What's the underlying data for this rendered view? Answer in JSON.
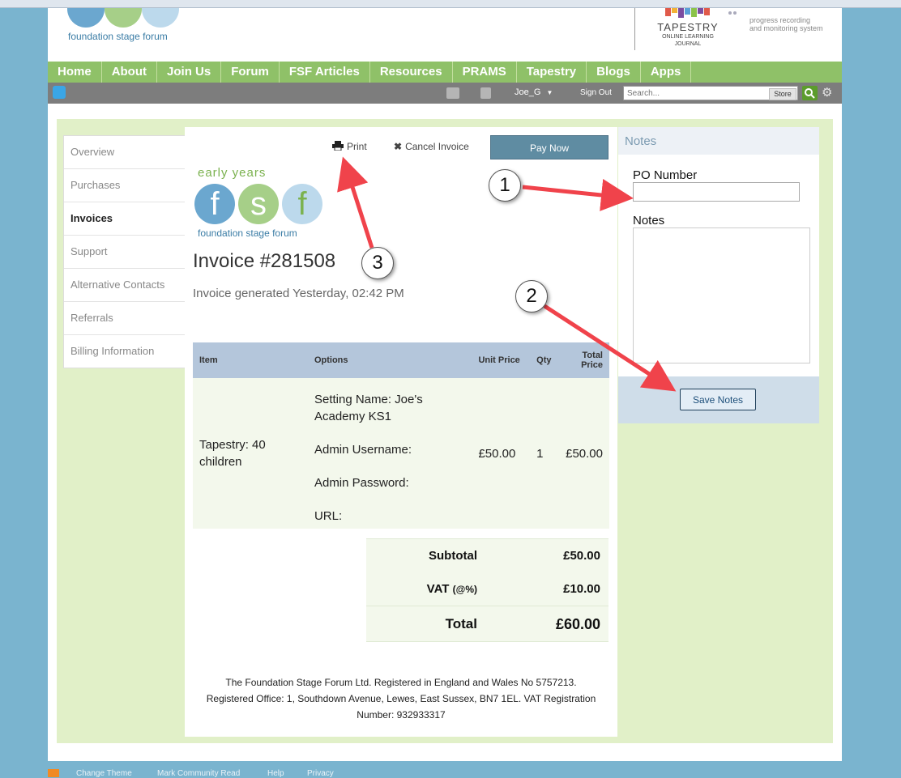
{
  "header": {
    "fsf_tagline": "foundation stage forum",
    "tapestry_title": "TAPESTRY",
    "tapestry_subtitle": "ONLINE LEARNING JOURNAL",
    "plans_line1": "progress recording",
    "plans_line2": "and monitoring system"
  },
  "nav": {
    "items": [
      "Home",
      "About",
      "Join Us",
      "Forum",
      "FSF Articles",
      "Resources",
      "PRAMS",
      "Tapestry",
      "Blogs",
      "Apps"
    ]
  },
  "userbar": {
    "username": "Joe_G",
    "sign_out": "Sign Out",
    "search_placeholder": "Search...",
    "store_label": "Store"
  },
  "sidebar": {
    "items": [
      "Overview",
      "Purchases",
      "Invoices",
      "Support",
      "Alternative Contacts",
      "Referrals",
      "Billing Information"
    ],
    "active": "Invoices"
  },
  "invoice": {
    "print_label": "Print",
    "cancel_label": "Cancel Invoice",
    "pay_label": "Pay Now",
    "logo_top": "early years",
    "logo_bottom": "foundation stage forum",
    "title": "Invoice #281508",
    "generated": "Invoice generated Yesterday, 02:42 PM",
    "table": {
      "headers": {
        "item": "Item",
        "options": "Options",
        "unit_price": "Unit Price",
        "qty": "Qty",
        "total_line1": "Total",
        "total_line2": "Price"
      },
      "rows": [
        {
          "item": "Tapestry: 40 children",
          "options": [
            "Setting Name: Joe's Academy KS1",
            "Admin Username:",
            "Admin Password:",
            "URL:"
          ],
          "unit_price": "£50.00",
          "qty": "1",
          "total": "£50.00"
        }
      ]
    },
    "totals": {
      "subtotal_label": "Subtotal",
      "subtotal_value": "£50.00",
      "vat_label": "VAT",
      "vat_suffix": "(@%)",
      "vat_value": "£10.00",
      "total_label": "Total",
      "total_value": "£60.00"
    },
    "footer": "The Foundation Stage Forum Ltd. Registered in England and Wales No 5757213. Registered Office: 1, Southdown Avenue, Lewes, East Sussex, BN7 1EL. VAT Registration Number: 932933317"
  },
  "notes_panel": {
    "heading": "Notes",
    "po_label": "PO Number",
    "po_value": "",
    "notes_label": "Notes",
    "notes_value": "",
    "save_label": "Save Notes"
  },
  "annotations": {
    "callout_1": "1",
    "callout_2": "2",
    "callout_3": "3"
  },
  "footer_links": [
    "Change Theme",
    "Mark Community Read",
    "Help",
    "Privacy"
  ],
  "colors": {
    "background": "#7ab4cf",
    "nav_green": "#8fc168",
    "content_green": "#e1f0c8",
    "pay_button": "#5f8ca2",
    "arrow_red": "#f0434b"
  }
}
